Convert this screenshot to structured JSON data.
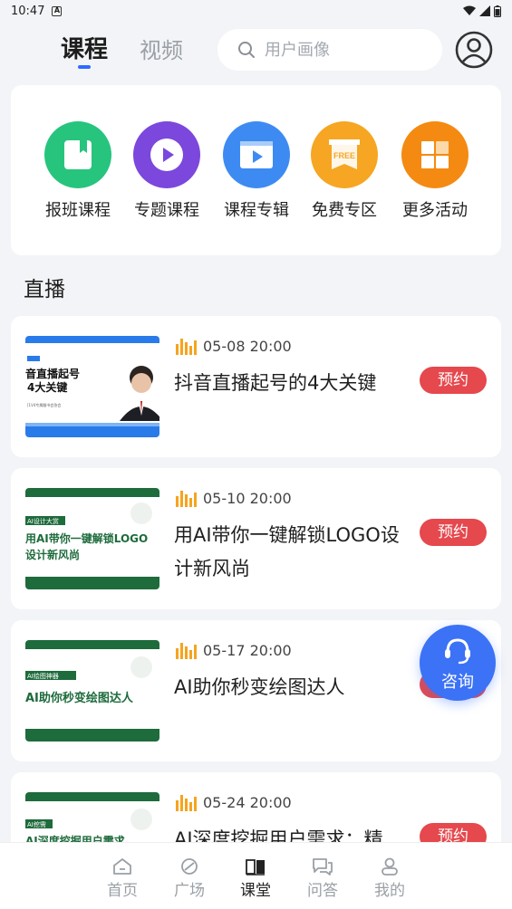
{
  "status_bar": {
    "time": "10:47",
    "notif_letter": "A"
  },
  "header": {
    "tabs": [
      {
        "label": "课程",
        "active": true
      },
      {
        "label": "视频",
        "active": false
      }
    ],
    "search_placeholder": "用户画像"
  },
  "quick_links": [
    {
      "label": "报班课程",
      "icon": "book-icon",
      "color": "#27c47e"
    },
    {
      "label": "专题课程",
      "icon": "play-circle-icon",
      "color": "#7b47dc"
    },
    {
      "label": "课程专辑",
      "icon": "video-album-icon",
      "color": "#3d8bf2"
    },
    {
      "label": "免费专区",
      "icon": "free-tag-icon",
      "color": "#f6a623",
      "badge_text": "FREE"
    },
    {
      "label": "更多活动",
      "icon": "grid-icon",
      "color": "#f48a12"
    }
  ],
  "live_section": {
    "title": "直播",
    "items": [
      {
        "time": "05-08 20:00",
        "title": "抖音直播起号的4大关键",
        "button": "预约",
        "thumb": {
          "line1": "音直播起号",
          "line2": "4大关键",
          "small": "[1V4专属翻书会答会",
          "tag": "直播"
        }
      },
      {
        "time": "05-10 20:00",
        "title": "用AI带你一键解锁LOGO设计新风尚",
        "button": "预约",
        "thumb": {
          "tag": "AI设计大赏",
          "line1": "用AI带你一键解锁LOGO",
          "line2": "设计新风尚"
        }
      },
      {
        "time": "05-17 20:00",
        "title": "AI助你秒变绘图达人",
        "button": "预约",
        "thumb": {
          "tag": "AI绘图神器",
          "line1": "AI助你秒变绘图达人"
        }
      },
      {
        "time": "05-24 20:00",
        "title": "AI深度挖掘用户需求：精",
        "button": "预约",
        "thumb": {
          "tag": "AI挖需",
          "line1": "AI深度挖掘用户需求"
        }
      }
    ]
  },
  "fab": {
    "label": "咨询"
  },
  "bottom_nav": [
    {
      "label": "首页",
      "icon": "home-icon",
      "active": false
    },
    {
      "label": "广场",
      "icon": "square-icon",
      "active": false
    },
    {
      "label": "课堂",
      "icon": "classroom-book-icon",
      "active": true
    },
    {
      "label": "问答",
      "icon": "qa-chat-icon",
      "active": false
    },
    {
      "label": "我的",
      "icon": "profile-icon",
      "active": false
    }
  ]
}
